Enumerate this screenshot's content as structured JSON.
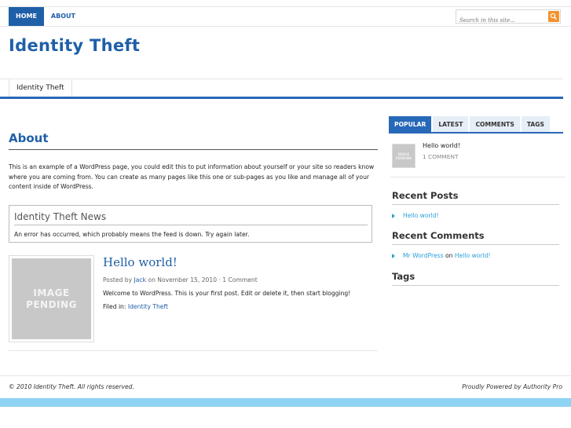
{
  "topnav": {
    "items": [
      {
        "label": "HOME",
        "active": true
      },
      {
        "label": "ABOUT",
        "active": false
      }
    ],
    "search_placeholder": "Search in this site..."
  },
  "site": {
    "title": "Identity Theft"
  },
  "subnav": {
    "items": [
      "Identity Theft"
    ]
  },
  "page": {
    "heading": "About",
    "body": "This is an example of a WordPress page, you could edit this to put information about yourself or your site so readers know where you are coming from. You can create as many pages like this one or sub-pages as you like and manage all of your content inside of WordPress."
  },
  "news_widget": {
    "title": "Identity Theft News",
    "message": "An error has occurred, which probably means the feed is down. Try again later."
  },
  "post": {
    "thumb_line1": "IMAGE",
    "thumb_line2": "PENDING",
    "title": "Hello world!",
    "meta_prefix": "Posted by",
    "author": "Jack",
    "meta_date": "on November 15, 2010 · 1 Comment",
    "excerpt": "Welcome to WordPress. This is your first post. Edit or delete it, then start blogging!",
    "filed_prefix": "Filed in:",
    "category": "Identity Theft"
  },
  "sidebar": {
    "tabs": [
      {
        "label": "POPULAR",
        "active": true
      },
      {
        "label": "LATEST",
        "active": false
      },
      {
        "label": "COMMENTS",
        "active": false
      },
      {
        "label": "TAGS",
        "active": false
      }
    ],
    "popular": {
      "thumb_line1": "IMAGE",
      "thumb_line2": "PENDING",
      "title": "Hello world!",
      "sub": "1 COMMENT"
    },
    "recent_posts_title": "Recent Posts",
    "recent_posts": [
      "Hello world!"
    ],
    "recent_comments_title": "Recent Comments",
    "recent_comment": {
      "author": "Mr WordPress",
      "on": "on",
      "post": "Hello world!"
    },
    "tags_title": "Tags"
  },
  "footer": {
    "left": "© 2010 Identity Theft. All rights reserved.",
    "right": "Proudly Powered by Authority Pro"
  },
  "colors": {
    "brand_blue": "#1f5fa8",
    "link_blue": "#2b9fd8",
    "search_button": "#f2922b",
    "bottom_band": "#8fd3f4"
  }
}
